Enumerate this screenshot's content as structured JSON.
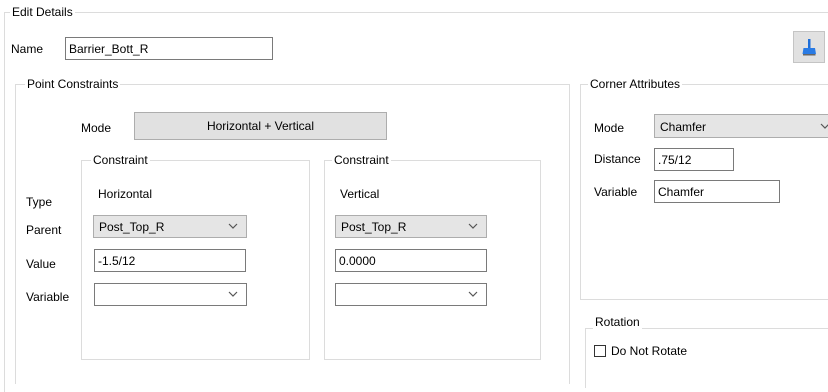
{
  "edit_details": {
    "legend": "Edit Details",
    "name_label": "Name",
    "name_value": "Barrier_Bott_R"
  },
  "point_constraints": {
    "legend": "Point Constraints",
    "mode_label": "Mode",
    "mode_button": "Horizontal + Vertical",
    "row_labels": {
      "type": "Type",
      "parent": "Parent",
      "value": "Value",
      "variable": "Variable"
    },
    "constraint_1": {
      "legend": "Constraint",
      "type": "Horizontal",
      "parent": "Post_Top_R",
      "value": "-1.5/12",
      "variable": ""
    },
    "constraint_2": {
      "legend": "Constraint",
      "type": "Vertical",
      "parent": "Post_Top_R",
      "value": "0.0000",
      "variable": ""
    }
  },
  "corner_attributes": {
    "legend": "Corner Attributes",
    "mode_label": "Mode",
    "mode_value": "Chamfer",
    "distance_label": "Distance",
    "distance_value": ".75/12",
    "variable_label": "Variable",
    "variable_value": "Chamfer"
  },
  "rotation": {
    "legend": "Rotation",
    "do_not_rotate_label": "Do Not Rotate",
    "do_not_rotate_checked": false
  },
  "toolbar": {
    "clear_icon": "broom-icon",
    "accent_color": "#1e6fd9"
  }
}
